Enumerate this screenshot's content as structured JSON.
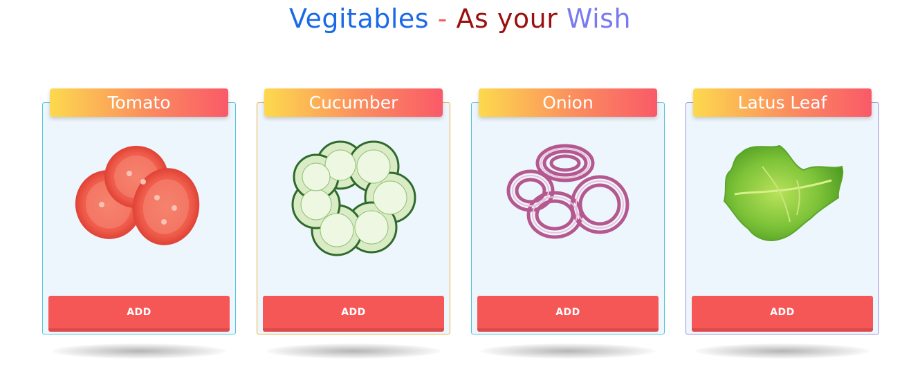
{
  "title": {
    "part1": "Vegitables",
    "separator": " - ",
    "part2": "As your ",
    "part3": "Wish",
    "colors": {
      "part1": "#1a6ae8",
      "separator": "#f45b5b",
      "part2": "#9c0f0f",
      "part3": "#7a7af0"
    }
  },
  "cards": [
    {
      "name": "Tomato",
      "image": "tomato-slices",
      "button_label": "ADD"
    },
    {
      "name": "Cucumber",
      "image": "cucumber-slices",
      "button_label": "ADD"
    },
    {
      "name": "Onion",
      "image": "onion-rings",
      "button_label": "ADD"
    },
    {
      "name": "Latus Leaf",
      "image": "lettuce-leaf",
      "button_label": "ADD"
    }
  ],
  "theme": {
    "header_gradient": [
      "#fdd94e",
      "#fb8c5e",
      "#f95a68"
    ],
    "card_background": "#eef6fd",
    "button_color": "#f55757"
  }
}
